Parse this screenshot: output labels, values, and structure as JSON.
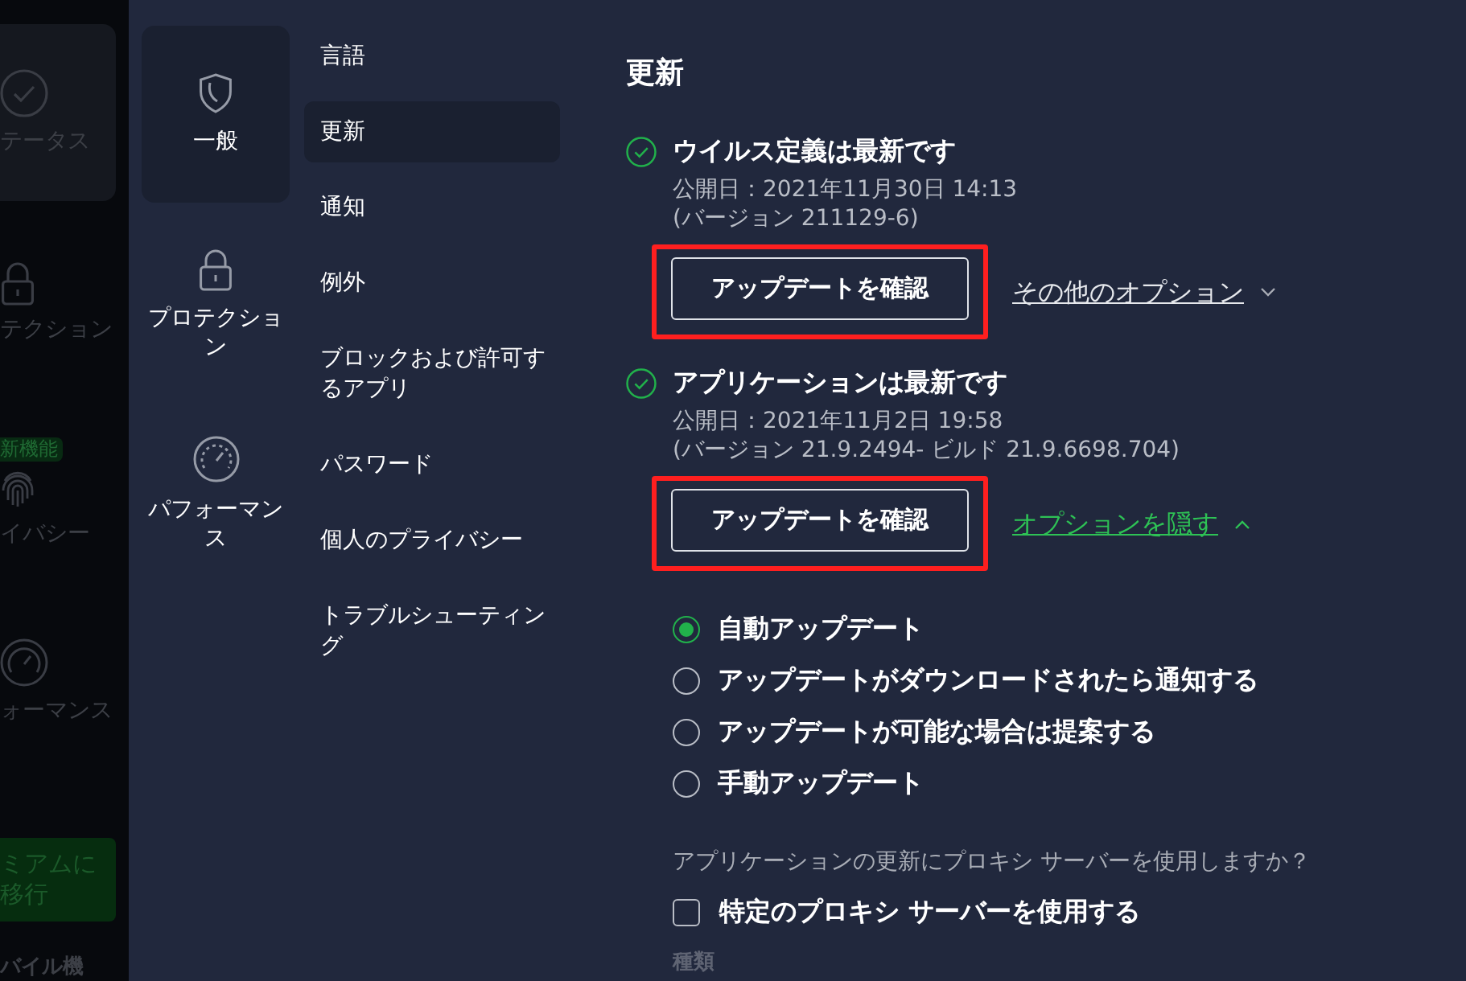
{
  "background_sidebar": {
    "items": [
      {
        "label": "テータス",
        "selected": true
      },
      {
        "label": "テクション",
        "selected": false
      },
      {
        "label": "イバシー",
        "selected": false,
        "badge": "新機能"
      },
      {
        "label": "ォーマンス",
        "selected": false
      }
    ],
    "upgrade_button": "ミアムに移行",
    "footer_item": "バイル機"
  },
  "categories": [
    {
      "label": "一般",
      "selected": true
    },
    {
      "label": "プロテクション",
      "selected": false
    },
    {
      "label": "パフォーマンス",
      "selected": false
    }
  ],
  "subnav": [
    {
      "label": "言語",
      "selected": false
    },
    {
      "label": "更新",
      "selected": true
    },
    {
      "label": "通知",
      "selected": false
    },
    {
      "label": "例外",
      "selected": false
    },
    {
      "label": "ブロックおよび許可するアプリ",
      "selected": false
    },
    {
      "label": "パスワード",
      "selected": false
    },
    {
      "label": "個人のプライバシー",
      "selected": false
    },
    {
      "label": "トラブルシューティング",
      "selected": false
    }
  ],
  "main": {
    "title": "更新",
    "updates": [
      {
        "title": "ウイルス定義は最新です",
        "lines": [
          "公開日：2021年11月30日 14:13",
          "(バージョン 211129-6)"
        ],
        "button": "アップデートを確認",
        "highlighted": true,
        "link": "その他のオプション",
        "expanded": false
      },
      {
        "title": "アプリケーションは最新です",
        "lines": [
          "公開日：2021年11月2日 19:58",
          "(バージョン 21.9.2494- ビルド 21.9.6698.704)"
        ],
        "button": "アップデートを確認",
        "highlighted": true,
        "link": "オプションを隠す",
        "expanded": true
      }
    ],
    "update_modes": [
      {
        "label": "自動アップデート",
        "selected": true
      },
      {
        "label": "アップデートがダウンロードされたら通知する",
        "selected": false
      },
      {
        "label": "アップデートが可能な場合は提案する",
        "selected": false
      },
      {
        "label": "手動アップデート",
        "selected": false
      }
    ],
    "proxy_question": "アプリケーションの更新にプロキシ サーバーを使用しますか？",
    "proxy_checkbox": {
      "label": "特定のプロキシ サーバーを使用する",
      "checked": false
    },
    "type_label": "種類"
  }
}
